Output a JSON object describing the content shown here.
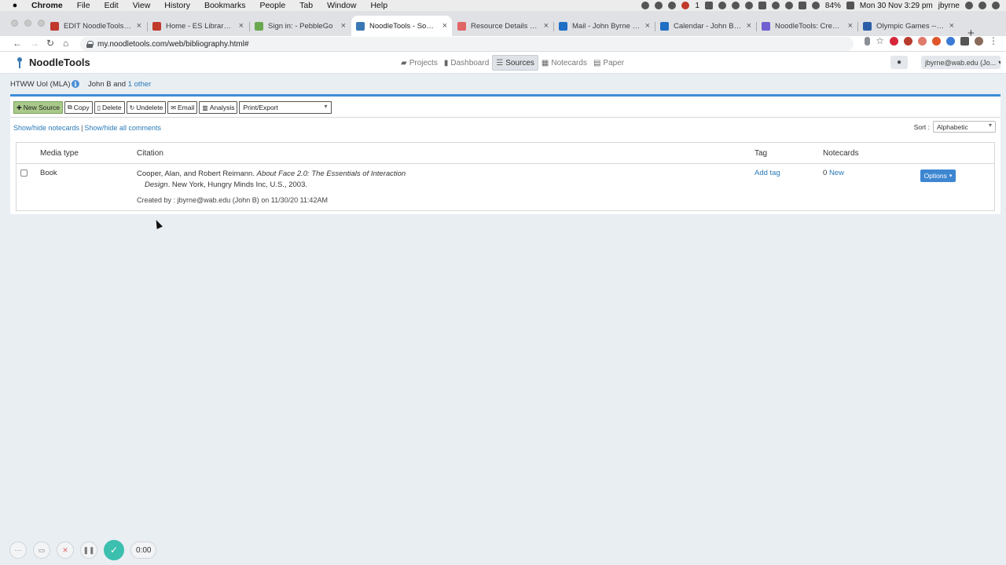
{
  "macos_menubar": {
    "app_name": "Chrome",
    "menus": [
      "File",
      "Edit",
      "View",
      "History",
      "Bookmarks",
      "People",
      "Tab",
      "Window",
      "Help"
    ],
    "battery": "84%",
    "clock": "Mon 30 Nov  3:29 pm",
    "user": "jbyrne",
    "notification_count": "1"
  },
  "browser": {
    "tabs": [
      {
        "label": "EDIT NoodleTools - ES",
        "favicon_color": "#c0392b",
        "active": false
      },
      {
        "label": "Home - ES Library - Li",
        "favicon_color": "#c0392b",
        "active": false
      },
      {
        "label": "Sign in: - PebbleGo",
        "favicon_color": "#6aa84f",
        "active": false
      },
      {
        "label": "NoodleTools - Sources",
        "favicon_color": "#3a78b5",
        "active": true
      },
      {
        "label": "Resource Details - We",
        "favicon_color": "#e06666",
        "active": false
      },
      {
        "label": "Mail - John Byrne - Ou",
        "favicon_color": "#1f6fc5",
        "active": false
      },
      {
        "label": "Calendar - John Byrne",
        "favicon_color": "#1f6fc5",
        "active": false
      },
      {
        "label": "NoodleTools: Create Pr",
        "favicon_color": "#6f5fd0",
        "active": false
      },
      {
        "label": "Olympic Games -- Brit",
        "favicon_color": "#2a5ea8",
        "active": false
      }
    ],
    "url": "my.noodletools.com/web/bibliography.html#"
  },
  "app": {
    "logo_text": "NoodleTools",
    "nav": [
      {
        "label": "Projects",
        "icon": "folder-icon",
        "glyph": "▰",
        "active": false
      },
      {
        "label": "Dashboard",
        "icon": "bar-chart-icon",
        "glyph": "▮",
        "active": false
      },
      {
        "label": "Sources",
        "icon": "list-icon",
        "glyph": "☰",
        "active": true
      },
      {
        "label": "Notecards",
        "icon": "grid-icon",
        "glyph": "▦",
        "active": false
      },
      {
        "label": "Paper",
        "icon": "document-icon",
        "glyph": "▤",
        "active": false
      }
    ],
    "user_menu": "jbyrne@wab.edu (Jo..."
  },
  "project": {
    "name": "HTWW UoI  (MLA)",
    "members_prefix": "John B  and ",
    "members_link": "1 other"
  },
  "toolbar": {
    "new_source": "New Source",
    "copy": "Copy",
    "delete": "Delete",
    "undelete": "Undelete",
    "email": "Email",
    "analysis": "Analysis",
    "print_export": "Print/Export"
  },
  "links": {
    "notecards": "Show/hide notecards",
    "comments": "Show/hide all comments"
  },
  "sort": {
    "label": "Sort :",
    "value": "Alphabetic"
  },
  "table": {
    "headers": {
      "media_type": "Media type",
      "citation": "Citation",
      "tag": "Tag",
      "notecards": "Notecards"
    },
    "rows": [
      {
        "media_type": "Book",
        "citation_authors": "Cooper, Alan, and Robert Reimann. ",
        "citation_title_1": "About Face 2.0: The Essentials of Interaction",
        "citation_title_2": "Design",
        "citation_rest": ". New York, Hungry Minds Inc, U.S., 2003.",
        "created_by": "Created by : jbyrne@wab.edu (John B) on 11/30/20 11:42AM",
        "tag_link": "Add tag",
        "notecard_count": "0",
        "notecard_new": "New",
        "options": "Options"
      }
    ]
  },
  "recorder": {
    "timer": "0:00"
  }
}
